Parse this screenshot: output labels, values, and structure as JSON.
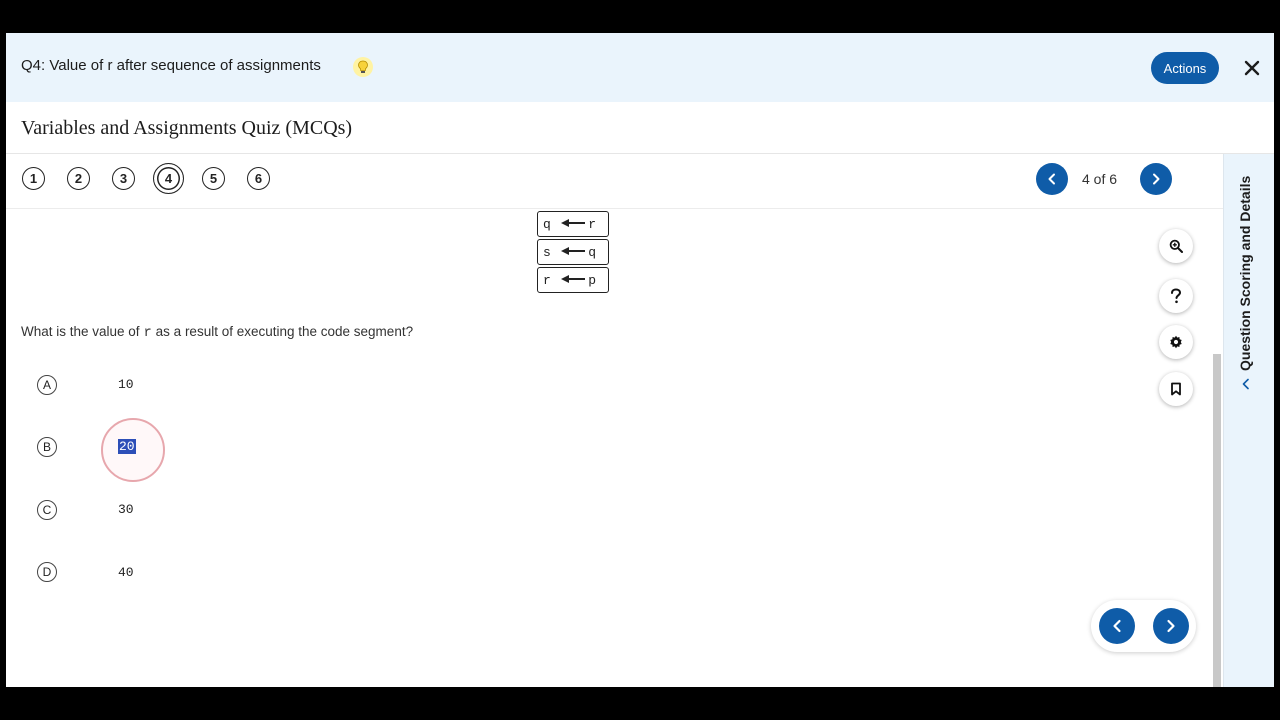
{
  "header": {
    "title": "Q4: Value of r after sequence of assignments",
    "hint_icon": "lightbulb-icon",
    "actions_label": "Actions",
    "close_icon": "close-icon",
    "accent_color": "#0f5ca8"
  },
  "quiz": {
    "title": "Variables and Assignments Quiz (MCQs)"
  },
  "question_nav": {
    "numbers": [
      "1",
      "2",
      "3",
      "4",
      "5",
      "6"
    ],
    "current": "4",
    "page_count": "4 of 6"
  },
  "side_panel": {
    "label": "Question Scoring and Details"
  },
  "code_segment": [
    {
      "left": "q",
      "right": "r"
    },
    {
      "left": "s",
      "right": "q"
    },
    {
      "left": "r",
      "right": "p"
    }
  ],
  "question": {
    "prefix": "What is the value of",
    "code": "r",
    "suffix": "as a result of executing the code segment?"
  },
  "options": [
    {
      "letter": "A",
      "value": "10"
    },
    {
      "letter": "B",
      "value": "20",
      "selected": true
    },
    {
      "letter": "C",
      "value": "30"
    },
    {
      "letter": "D",
      "value": "40"
    }
  ],
  "tools": [
    "zoom-in-icon",
    "help-icon",
    "settings-icon",
    "bookmark-icon"
  ]
}
